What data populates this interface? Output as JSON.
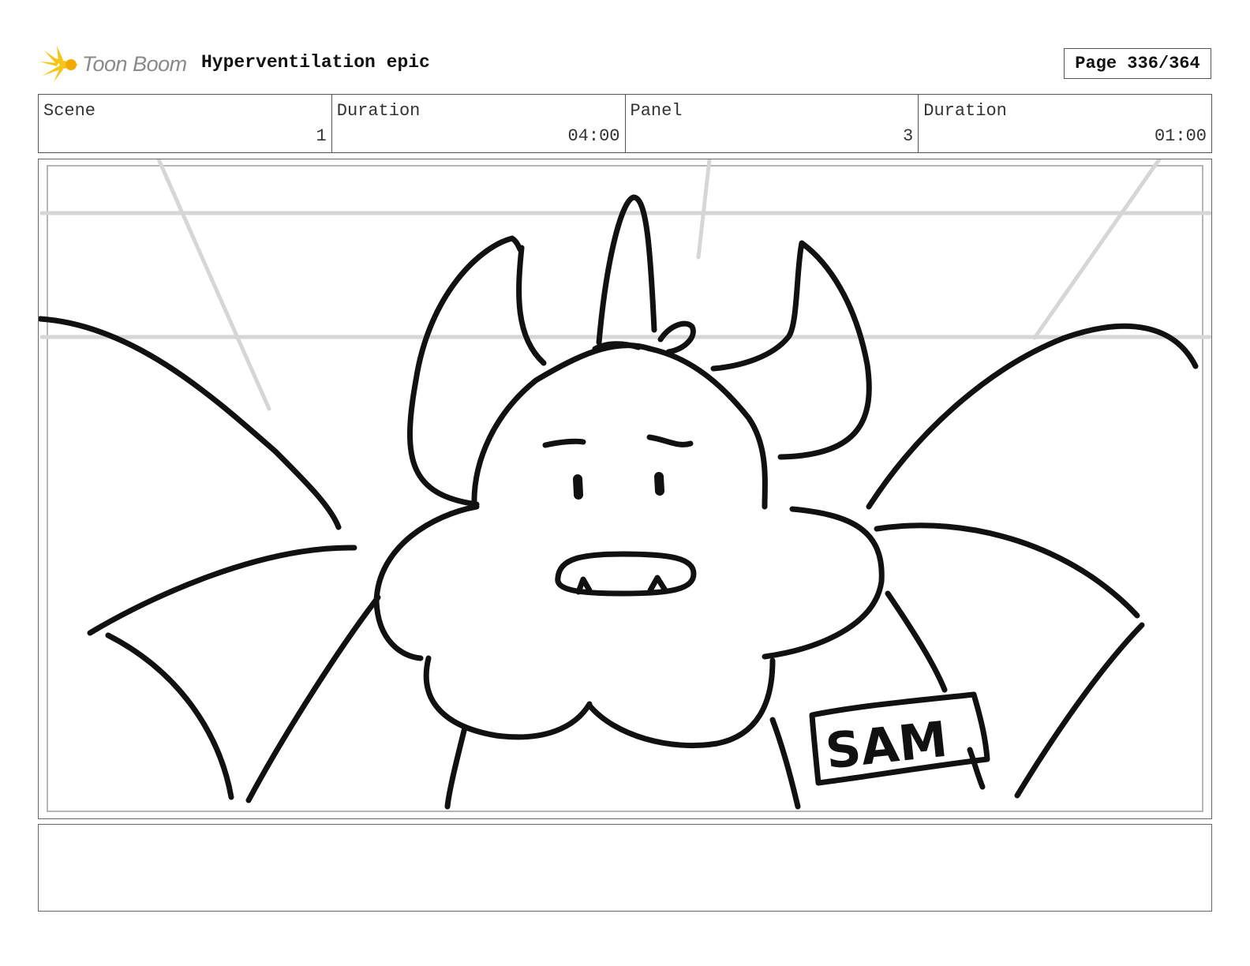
{
  "header": {
    "logo_text": "Toon Boom",
    "title": "Hyperventilation epic",
    "page": "Page 336/364"
  },
  "info": {
    "scene_label": "Scene",
    "scene_value": "1",
    "scene_duration_label": "Duration",
    "scene_duration_value": "04:00",
    "panel_label": "Panel",
    "panel_value": "3",
    "panel_duration_label": "Duration",
    "panel_duration_value": "01:00"
  },
  "drawing": {
    "name_tag": "SAM"
  },
  "colors": {
    "logo_accent": "#f5c518",
    "ink": "#111111",
    "guide_lines": "#d6d6d6"
  },
  "notes": {
    "text": ""
  }
}
